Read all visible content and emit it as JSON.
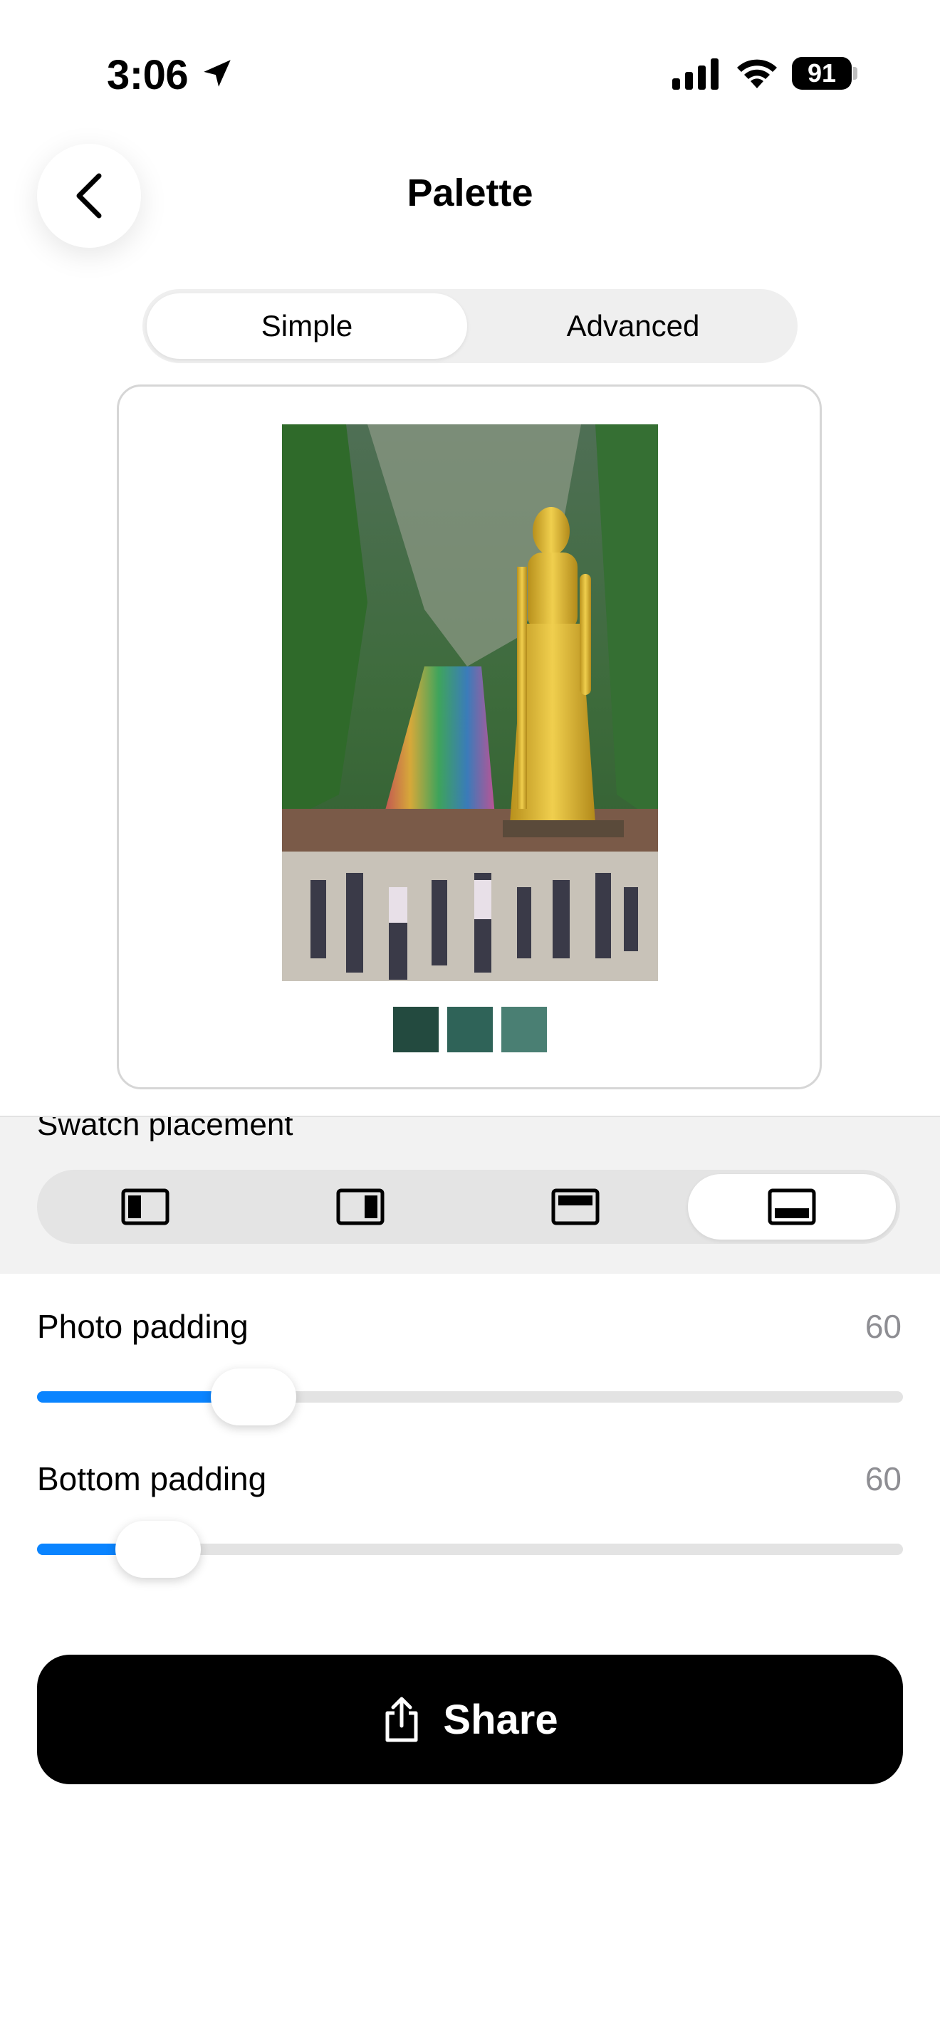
{
  "status_bar": {
    "time": "3:06",
    "battery": "91"
  },
  "nav": {
    "title": "Palette"
  },
  "mode_tabs": [
    {
      "label": "Simple",
      "selected": true
    },
    {
      "label": "Advanced",
      "selected": false
    }
  ],
  "preview": {
    "swatches": [
      "#234a3f",
      "#2f6358",
      "#4a7f73"
    ]
  },
  "swatch_placement": {
    "label": "Swatch placement",
    "options": [
      "left-swatch-icon",
      "right-swatch-icon",
      "top-swatch-icon",
      "bottom-swatch-icon"
    ],
    "selected": 3
  },
  "photo_padding": {
    "label": "Photo padding",
    "value": "60",
    "level": 0.25
  },
  "bottom_padding": {
    "label": "Bottom padding",
    "value": "60",
    "level": 0.14
  },
  "share_button": {
    "label": "Share"
  },
  "colors": {
    "accent": "#0a84ff",
    "button": "#000000"
  }
}
